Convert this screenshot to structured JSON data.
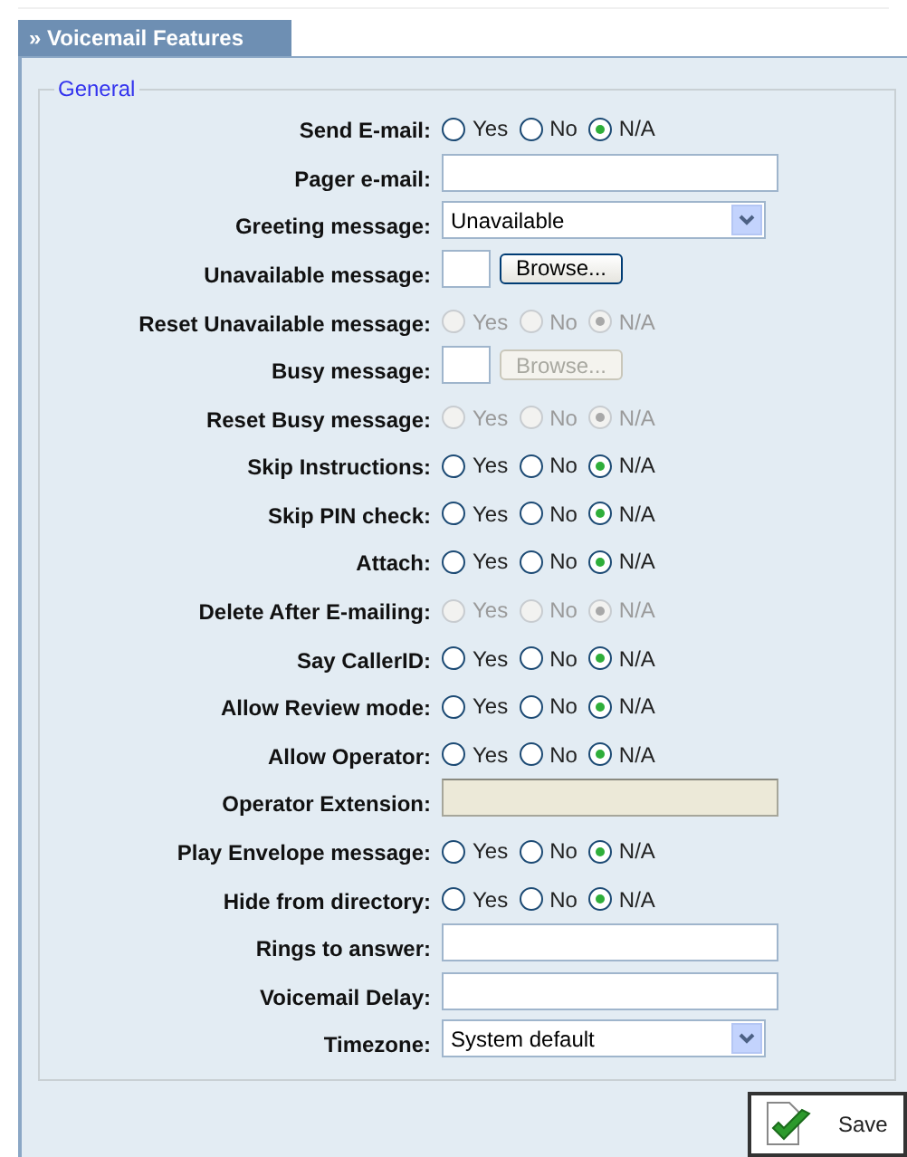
{
  "tab": {
    "label": "» Voicemail Features"
  },
  "fieldset": {
    "legend": "General"
  },
  "rows": [
    {
      "kind": "radio",
      "label": "Send E-mail:",
      "disabled": false,
      "options": [
        {
          "label": "Yes",
          "selected": false
        },
        {
          "label": "No",
          "selected": false
        },
        {
          "label": "N/A",
          "selected": true
        }
      ]
    },
    {
      "kind": "text",
      "label": "Pager e-mail:",
      "disabled": false
    },
    {
      "kind": "select",
      "label": "Greeting message:",
      "value": "Unavailable"
    },
    {
      "kind": "file",
      "label": "Unavailable message:",
      "disabled": false,
      "button": "Browse..."
    },
    {
      "kind": "radio",
      "label": "Reset Unavailable message:",
      "disabled": true,
      "options": [
        {
          "label": "Yes",
          "selected": false
        },
        {
          "label": "No",
          "selected": false
        },
        {
          "label": "N/A",
          "selected": true
        }
      ]
    },
    {
      "kind": "file",
      "label": "Busy message:",
      "disabled": true,
      "button": "Browse..."
    },
    {
      "kind": "radio",
      "label": "Reset Busy message:",
      "disabled": true,
      "options": [
        {
          "label": "Yes",
          "selected": false
        },
        {
          "label": "No",
          "selected": false
        },
        {
          "label": "N/A",
          "selected": true
        }
      ]
    },
    {
      "kind": "radio",
      "label": "Skip Instructions:",
      "disabled": false,
      "options": [
        {
          "label": "Yes",
          "selected": false
        },
        {
          "label": "No",
          "selected": false
        },
        {
          "label": "N/A",
          "selected": true
        }
      ]
    },
    {
      "kind": "radio",
      "label": "Skip PIN check:",
      "disabled": false,
      "options": [
        {
          "label": "Yes",
          "selected": false
        },
        {
          "label": "No",
          "selected": false
        },
        {
          "label": "N/A",
          "selected": true
        }
      ]
    },
    {
      "kind": "radio",
      "label": "Attach:",
      "disabled": false,
      "options": [
        {
          "label": "Yes",
          "selected": false
        },
        {
          "label": "No",
          "selected": false
        },
        {
          "label": "N/A",
          "selected": true
        }
      ]
    },
    {
      "kind": "radio",
      "label": "Delete After E-mailing:",
      "disabled": true,
      "options": [
        {
          "label": "Yes",
          "selected": false
        },
        {
          "label": "No",
          "selected": false
        },
        {
          "label": "N/A",
          "selected": true
        }
      ]
    },
    {
      "kind": "radio",
      "label": "Say CallerID:",
      "disabled": false,
      "options": [
        {
          "label": "Yes",
          "selected": false
        },
        {
          "label": "No",
          "selected": false
        },
        {
          "label": "N/A",
          "selected": true
        }
      ]
    },
    {
      "kind": "radio",
      "label": "Allow Review mode:",
      "disabled": false,
      "options": [
        {
          "label": "Yes",
          "selected": false
        },
        {
          "label": "No",
          "selected": false
        },
        {
          "label": "N/A",
          "selected": true
        }
      ]
    },
    {
      "kind": "radio",
      "label": "Allow Operator:",
      "disabled": false,
      "options": [
        {
          "label": "Yes",
          "selected": false
        },
        {
          "label": "No",
          "selected": false
        },
        {
          "label": "N/A",
          "selected": true
        }
      ]
    },
    {
      "kind": "text",
      "label": "Operator Extension:",
      "disabled": true
    },
    {
      "kind": "radio",
      "label": "Play Envelope message:",
      "disabled": false,
      "options": [
        {
          "label": "Yes",
          "selected": false
        },
        {
          "label": "No",
          "selected": false
        },
        {
          "label": "N/A",
          "selected": true
        }
      ]
    },
    {
      "kind": "radio",
      "label": "Hide from directory:",
      "disabled": false,
      "options": [
        {
          "label": "Yes",
          "selected": false
        },
        {
          "label": "No",
          "selected": false
        },
        {
          "label": "N/A",
          "selected": true
        }
      ]
    },
    {
      "kind": "text",
      "label": "Rings to answer:",
      "disabled": false
    },
    {
      "kind": "text",
      "label": "Voicemail Delay:",
      "disabled": false
    },
    {
      "kind": "select",
      "label": "Timezone:",
      "value": "System default"
    }
  ],
  "save_button": {
    "label": "Save"
  }
}
